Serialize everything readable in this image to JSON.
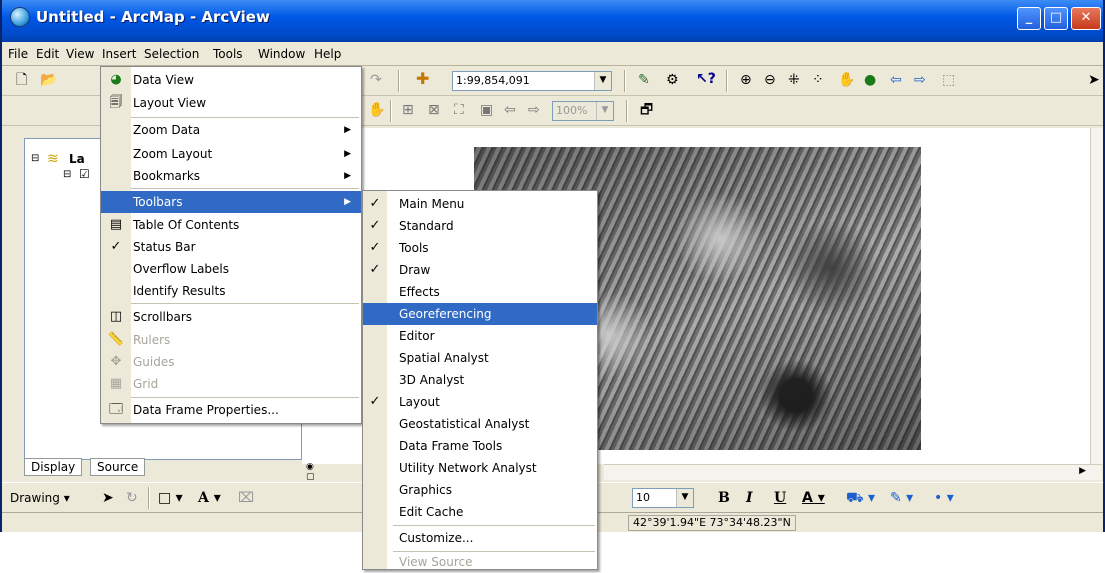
{
  "window": {
    "title": "Untitled - ArcMap - ArcView"
  },
  "menubar": {
    "items": [
      "File",
      "Edit",
      "View",
      "Insert",
      "Selection",
      "Tools",
      "Window",
      "Help"
    ]
  },
  "toolbar": {
    "scale": "1:99,854,091",
    "zoom": "100%"
  },
  "toc": {
    "layers_label": "La"
  },
  "tabs": {
    "display": "Display",
    "source": "Source"
  },
  "drawing": {
    "label": "Drawing",
    "font_size": "10",
    "bold": "B",
    "italic": "I",
    "underline": "U"
  },
  "status": {
    "coords": "42°39'1.94\"E  73°34'48.23\"N"
  },
  "view_menu": [
    {
      "label": "Data View",
      "icon": "data-view-icon"
    },
    {
      "label": "Layout View",
      "icon": "layout-view-icon"
    },
    {
      "label": "Zoom Data",
      "submenu": true
    },
    {
      "label": "Zoom Layout",
      "submenu": true
    },
    {
      "label": "Bookmarks",
      "submenu": true
    },
    {
      "label": "Toolbars",
      "submenu": true,
      "selected": true
    },
    {
      "label": "Table Of Contents",
      "icon": "table-of-contents-icon"
    },
    {
      "label": "Status Bar",
      "checked": true
    },
    {
      "label": "Overflow Labels"
    },
    {
      "label": "Identify Results"
    },
    {
      "label": "Scrollbars",
      "icon": "scrollbars-icon"
    },
    {
      "label": "Rulers",
      "disabled": true,
      "icon": "rulers-icon"
    },
    {
      "label": "Guides",
      "disabled": true,
      "icon": "guides-icon"
    },
    {
      "label": "Grid",
      "disabled": true,
      "icon": "grid-icon"
    },
    {
      "label": "Data Frame Properties...",
      "icon": "data-frame-properties-icon"
    }
  ],
  "toolbars_menu": [
    {
      "label": "Main Menu",
      "checked": true
    },
    {
      "label": "Standard",
      "checked": true
    },
    {
      "label": "Tools",
      "checked": true
    },
    {
      "label": "Draw",
      "checked": true
    },
    {
      "label": "Effects"
    },
    {
      "label": "Georeferencing",
      "selected": true
    },
    {
      "label": "Editor"
    },
    {
      "label": "Spatial Analyst"
    },
    {
      "label": "3D Analyst"
    },
    {
      "label": "Layout",
      "checked": true
    },
    {
      "label": "Geostatistical Analyst"
    },
    {
      "label": "Data Frame Tools"
    },
    {
      "label": "Utility Network Analyst"
    },
    {
      "label": "Graphics"
    },
    {
      "label": "Edit Cache"
    },
    {
      "label": "Customize..."
    },
    {
      "label": "View Source",
      "disabled": true
    }
  ],
  "colors": {
    "titlebar": "#0058e6",
    "selection": "#316ac5",
    "face": "#ece9d8"
  }
}
